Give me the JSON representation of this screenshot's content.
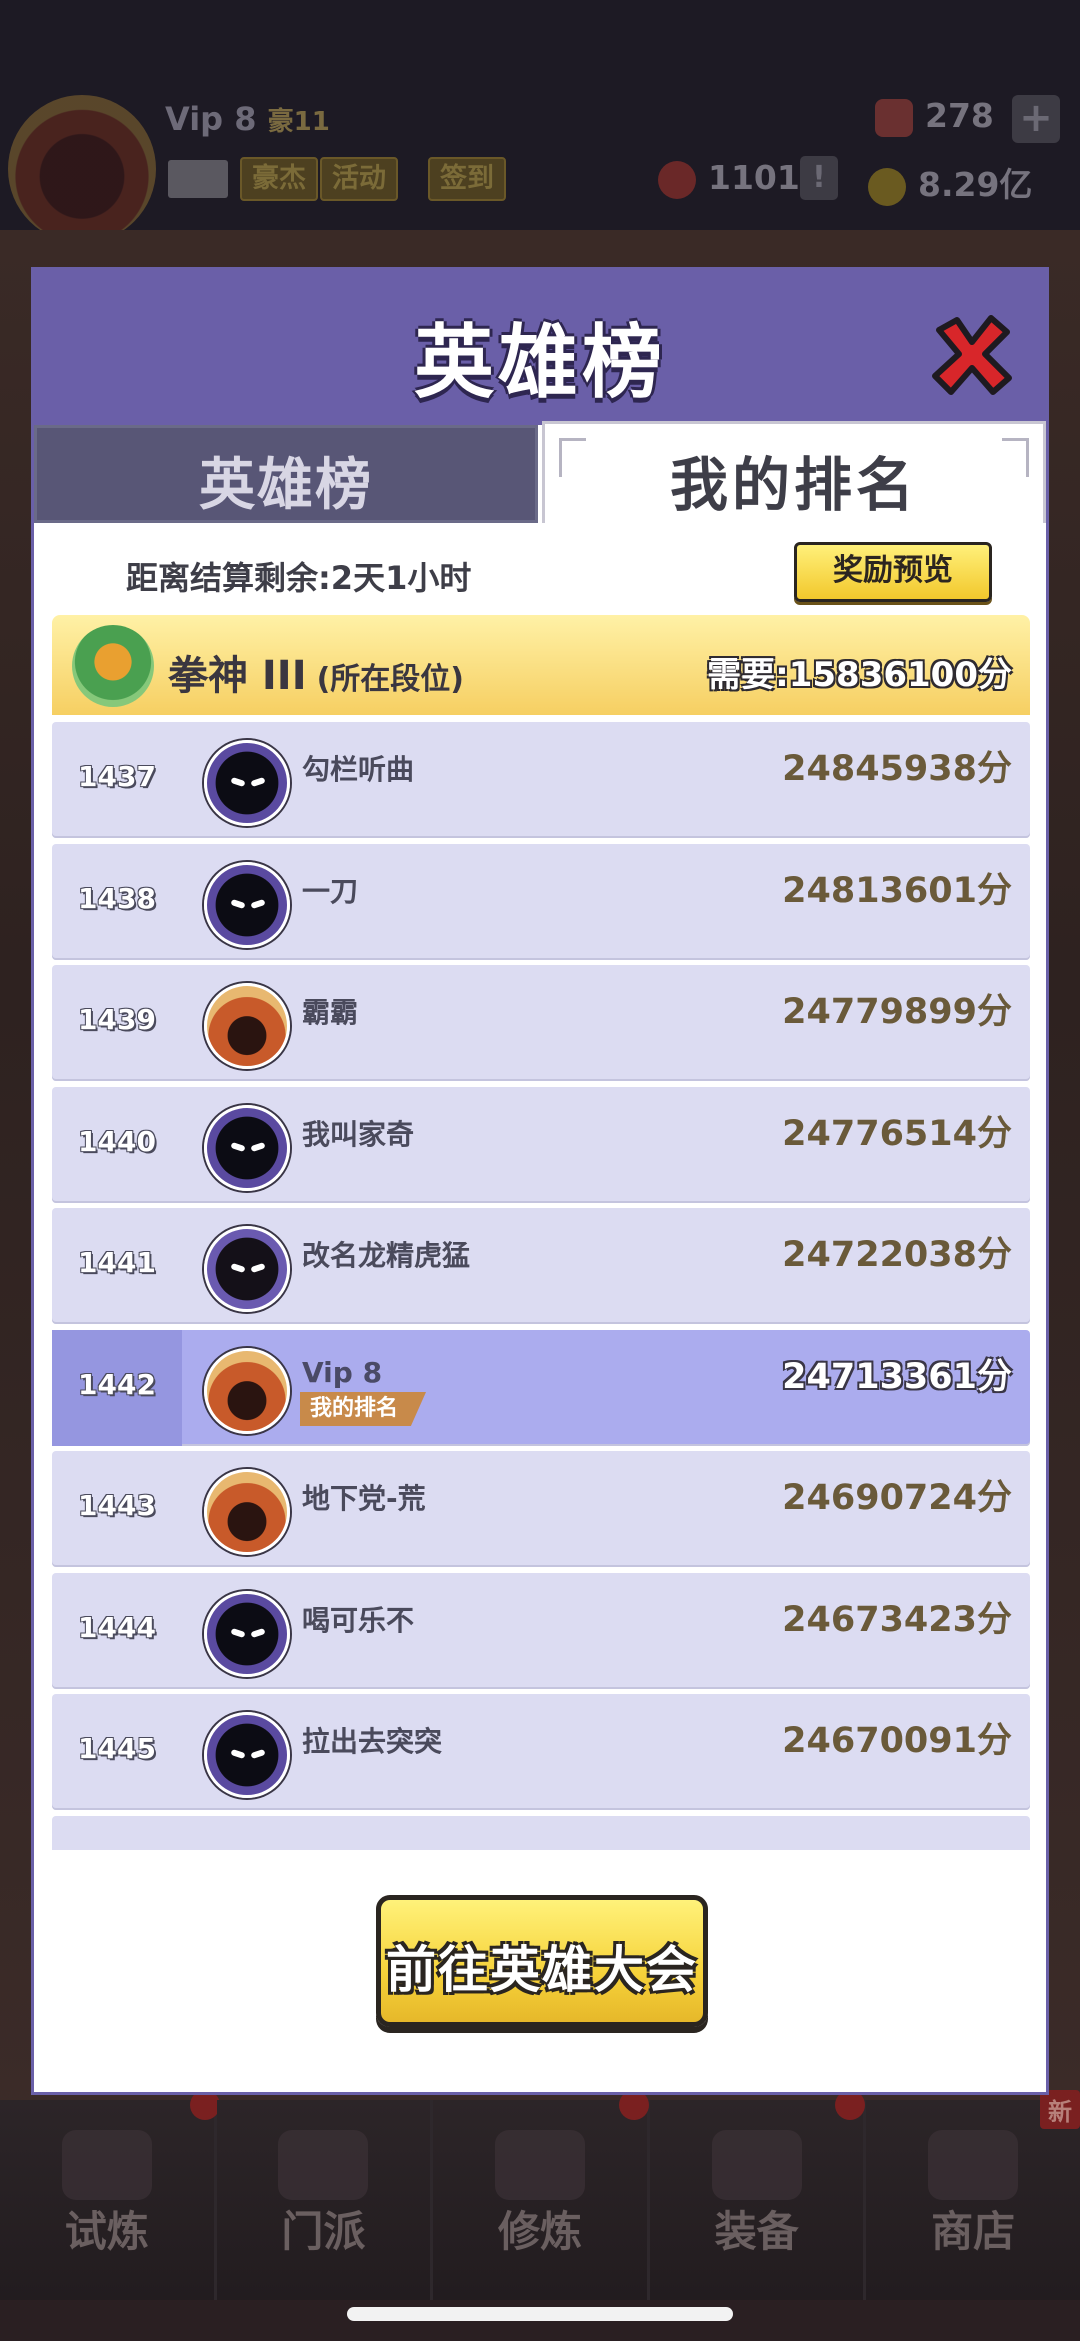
{
  "background": {
    "player_name": "Vip 8",
    "hao_level": "豪11",
    "chips": [
      "豪杰",
      "活动",
      "签到"
    ],
    "gem_count": "278",
    "ticket_count": "1101",
    "gold": "8.29亿",
    "plus": "+",
    "alert": "!"
  },
  "bottom_nav": {
    "tabs": [
      {
        "label": "试炼"
      },
      {
        "label": "门派"
      },
      {
        "label": "修炼"
      },
      {
        "label": "装备"
      },
      {
        "label": "商店"
      }
    ],
    "new_badge": "新"
  },
  "modal": {
    "title": "英雄榜",
    "tabs": {
      "left": "英雄榜",
      "right": "我的排名"
    },
    "countdown": "距离结算剩余:2天1小时",
    "reward_preview": "奖励预览",
    "tier": {
      "name": "拳神 III",
      "note": "(所在段位)",
      "need": "需要:15836100分"
    },
    "my_rank_tag": "我的排名",
    "rows": [
      {
        "rank": "1437",
        "name": "勾栏听曲",
        "score": "24845938分",
        "avatar": "ninja-avatar",
        "mine": false
      },
      {
        "rank": "1438",
        "name": "一刀",
        "score": "24813601分",
        "avatar": "ninja-avatar",
        "mine": false
      },
      {
        "rank": "1439",
        "name": "霸霸",
        "score": "24779899分",
        "avatar": "rabbit-avatar",
        "mine": false
      },
      {
        "rank": "1440",
        "name": "我叫家奇",
        "score": "24776514分",
        "avatar": "ninja-avatar",
        "mine": false
      },
      {
        "rank": "1441",
        "name": "改名龙精虎猛",
        "score": "24722038分",
        "avatar": "ninja-avatar",
        "mine": false
      },
      {
        "rank": "1442",
        "name": "Vip 8",
        "score": "24713361分",
        "avatar": "rabbit-avatar",
        "mine": true
      },
      {
        "rank": "1443",
        "name": "地下党-荒",
        "score": "24690724分",
        "avatar": "rabbit-avatar",
        "mine": false
      },
      {
        "rank": "1444",
        "name": "喝可乐不",
        "score": "24673423分",
        "avatar": "ninja-avatar",
        "mine": false
      },
      {
        "rank": "1445",
        "name": "拉出去突突",
        "score": "24670091分",
        "avatar": "ninja-avatar",
        "mine": false
      }
    ],
    "goto_button": "前往英雄大会"
  },
  "colors": {
    "header": "#6a5fa8",
    "row": "#dcdcf2",
    "row_mine": "#abacee",
    "tier_gold": "#f6cf62",
    "button_yellow": "#f6d23a"
  }
}
